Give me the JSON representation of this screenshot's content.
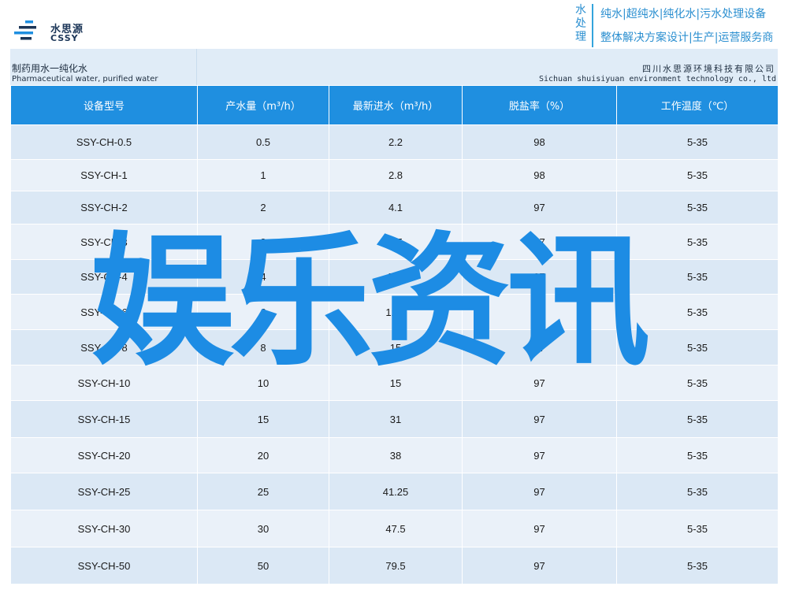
{
  "header": {
    "logo_cn": "水思源",
    "logo_en": "CSSY",
    "vertical_label": [
      "水",
      "处",
      "理"
    ],
    "tagline_1": "纯水|超纯水|纯化水|污水处理设备",
    "tagline_2": "整体解决方案设计|生产|运营服务商"
  },
  "subheader": {
    "title_cn": "制药用水一纯化水",
    "title_en": "Pharmaceutical water, purified water",
    "company_cn": "四川水思源环境科技有限公司",
    "company_en": "Sichuan shuisiyuan environment technology co., ltd"
  },
  "table": {
    "headers": [
      "设备型号",
      "产水量（m³/h）",
      "最新进水（m³/h）",
      "脱盐率（%）",
      "工作温度（℃）"
    ],
    "rows": [
      [
        "SSY-CH-0.5",
        "0.5",
        "2.2",
        "98",
        "5-35"
      ],
      [
        "SSY-CH-1",
        "1",
        "2.8",
        "98",
        "5-35"
      ],
      [
        "SSY-CH-2",
        "2",
        "4.1",
        "97",
        "5-35"
      ],
      [
        "SSY-CH-3",
        "3",
        "6.5",
        "97",
        "5-35"
      ],
      [
        "SSY-CH-4",
        "4",
        "7.8",
        "97",
        "5-35"
      ],
      [
        "SSY-CH-6",
        "6",
        "12.5",
        "97",
        "5-35"
      ],
      [
        "SSY-CH-8",
        "8",
        "15",
        "97",
        "5-35"
      ],
      [
        "SSY-CH-10",
        "10",
        "15",
        "97",
        "5-35"
      ],
      [
        "SSY-CH-15",
        "15",
        "31",
        "97",
        "5-35"
      ],
      [
        "SSY-CH-20",
        "20",
        "38",
        "97",
        "5-35"
      ],
      [
        "SSY-CH-25",
        "25",
        "41.25",
        "97",
        "5-35"
      ],
      [
        "SSY-CH-30",
        "30",
        "47.5",
        "97",
        "5-35"
      ],
      [
        "SSY-CH-50",
        "50",
        "79.5",
        "97",
        "5-35"
      ]
    ]
  },
  "overlay": {
    "text": "娱乐资讯"
  },
  "colors": {
    "accent": "#1f8fe0",
    "row_a": "#dbe8f5",
    "row_b": "#eaf1f9",
    "overlay": "#1d8ce4"
  }
}
